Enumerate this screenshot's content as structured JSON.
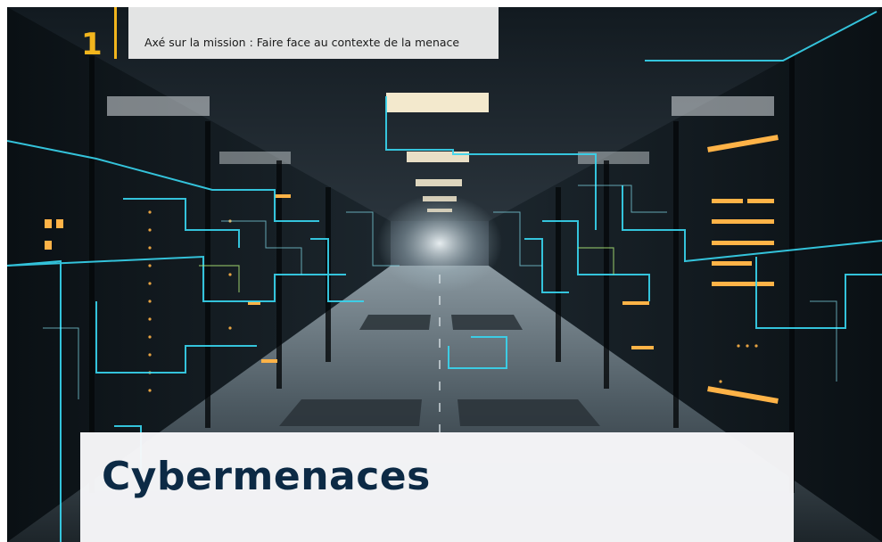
{
  "header": {
    "section_number": "1",
    "text": "Axé sur la mission : Faire face au contexte de la menace"
  },
  "title": {
    "text": "Cybermenaces"
  },
  "background": {
    "subject": "server-room-data-center-photo",
    "colors": {
      "dark": "#0d1419",
      "cyan_light": "#38d6f0",
      "amber_light": "#ffb347",
      "ceiling_light": "#fff3d6"
    }
  },
  "colors": {
    "accent": "#f2b51d",
    "title": "#0c2a45",
    "header_box": "#ececec",
    "title_card": "#f8f8fa"
  }
}
